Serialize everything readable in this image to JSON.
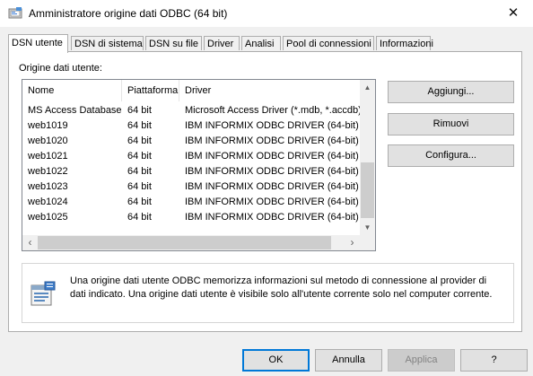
{
  "window": {
    "title": "Amministratore origine dati ODBC (64 bit)",
    "close_symbol": "✕",
    "title_icon": "odbc-admin-icon"
  },
  "tabs": [
    {
      "label": "DSN utente",
      "active": true
    },
    {
      "label": "DSN di sistema",
      "active": false
    },
    {
      "label": "DSN su file",
      "active": false
    },
    {
      "label": "Driver",
      "active": false
    },
    {
      "label": "Analisi",
      "active": false
    },
    {
      "label": "Pool di connessioni",
      "active": false
    },
    {
      "label": "Informazioni",
      "active": false
    }
  ],
  "group_label": "Origine dati utente:",
  "list": {
    "columns": [
      "Nome",
      "Piattaforma",
      "Driver"
    ],
    "rows": [
      [
        "MS Access Database",
        "64 bit",
        "Microsoft Access Driver (*.mdb, *.accdb)"
      ],
      [
        "web1019",
        "64 bit",
        "IBM INFORMIX ODBC DRIVER (64-bit)"
      ],
      [
        "web1020",
        "64 bit",
        "IBM INFORMIX ODBC DRIVER (64-bit)"
      ],
      [
        "web1021",
        "64 bit",
        "IBM INFORMIX ODBC DRIVER (64-bit)"
      ],
      [
        "web1022",
        "64 bit",
        "IBM INFORMIX ODBC DRIVER (64-bit)"
      ],
      [
        "web1023",
        "64 bit",
        "IBM INFORMIX ODBC DRIVER (64-bit)"
      ],
      [
        "web1024",
        "64 bit",
        "IBM INFORMIX ODBC DRIVER (64-bit)"
      ],
      [
        "web1025",
        "64 bit",
        "IBM INFORMIX ODBC DRIVER (64-bit)"
      ]
    ]
  },
  "side_buttons": {
    "add": "Aggiungi...",
    "remove": "Rimuovi",
    "configure": "Configura..."
  },
  "info": {
    "text": "Una origine dati utente ODBC memorizza informazioni sul metodo di connessione al provider di dati indicato. Una origine dati utente è visibile solo all'utente corrente solo nel computer corrente.",
    "icon": "database-info-icon"
  },
  "bottom_buttons": {
    "ok": "OK",
    "cancel": "Annulla",
    "apply": "Applica",
    "help": "?"
  },
  "colors": {
    "accent": "#0078d7",
    "window_bg": "#f0f0f0"
  }
}
